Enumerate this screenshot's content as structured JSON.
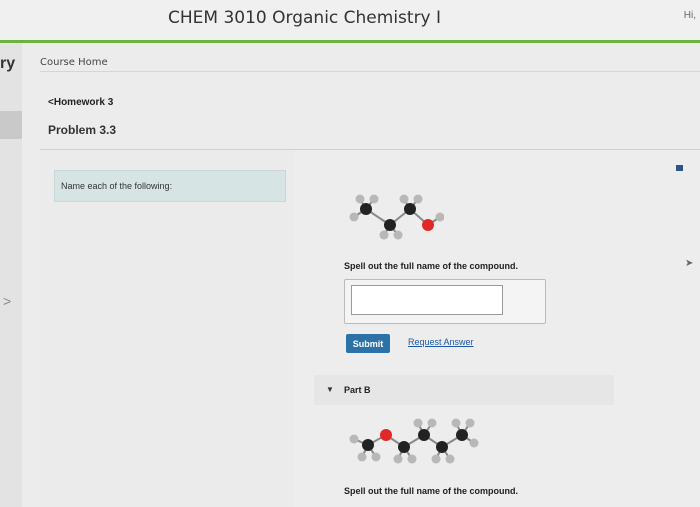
{
  "header": {
    "course_title": "CHEM 3010 Organic Chemistry I",
    "top_right_text": "Hi,"
  },
  "sidebar": {
    "truncated_text": "ry",
    "arrow_glyph": ">"
  },
  "nav": {
    "course_home": "Course Home",
    "homework_link": "Homework 3",
    "homework_chevron": "<"
  },
  "problem": {
    "title": "Problem 3.3",
    "instructions": "Name each of the following:"
  },
  "part_a": {
    "prompt": "Spell out the full name of the compound.",
    "answer_value": "",
    "submit_label": "Submit",
    "request_answer_label": "Request Answer"
  },
  "part_b": {
    "label": "Part B",
    "caret": "▼",
    "prompt": "Spell out the full name of the compound."
  },
  "colors": {
    "accent_green": "#6cb33e",
    "button_blue": "#2c72a6",
    "link_blue": "#1d58a8",
    "instruction_bg": "#d6e4e4",
    "atom_carbon": "#222222",
    "atom_hydrogen": "#b8b8b8",
    "atom_oxygen": "#e02828"
  },
  "icons": {
    "right_edge": "grid-icon",
    "right_edge_arrow": "pointer-arrow-icon"
  }
}
